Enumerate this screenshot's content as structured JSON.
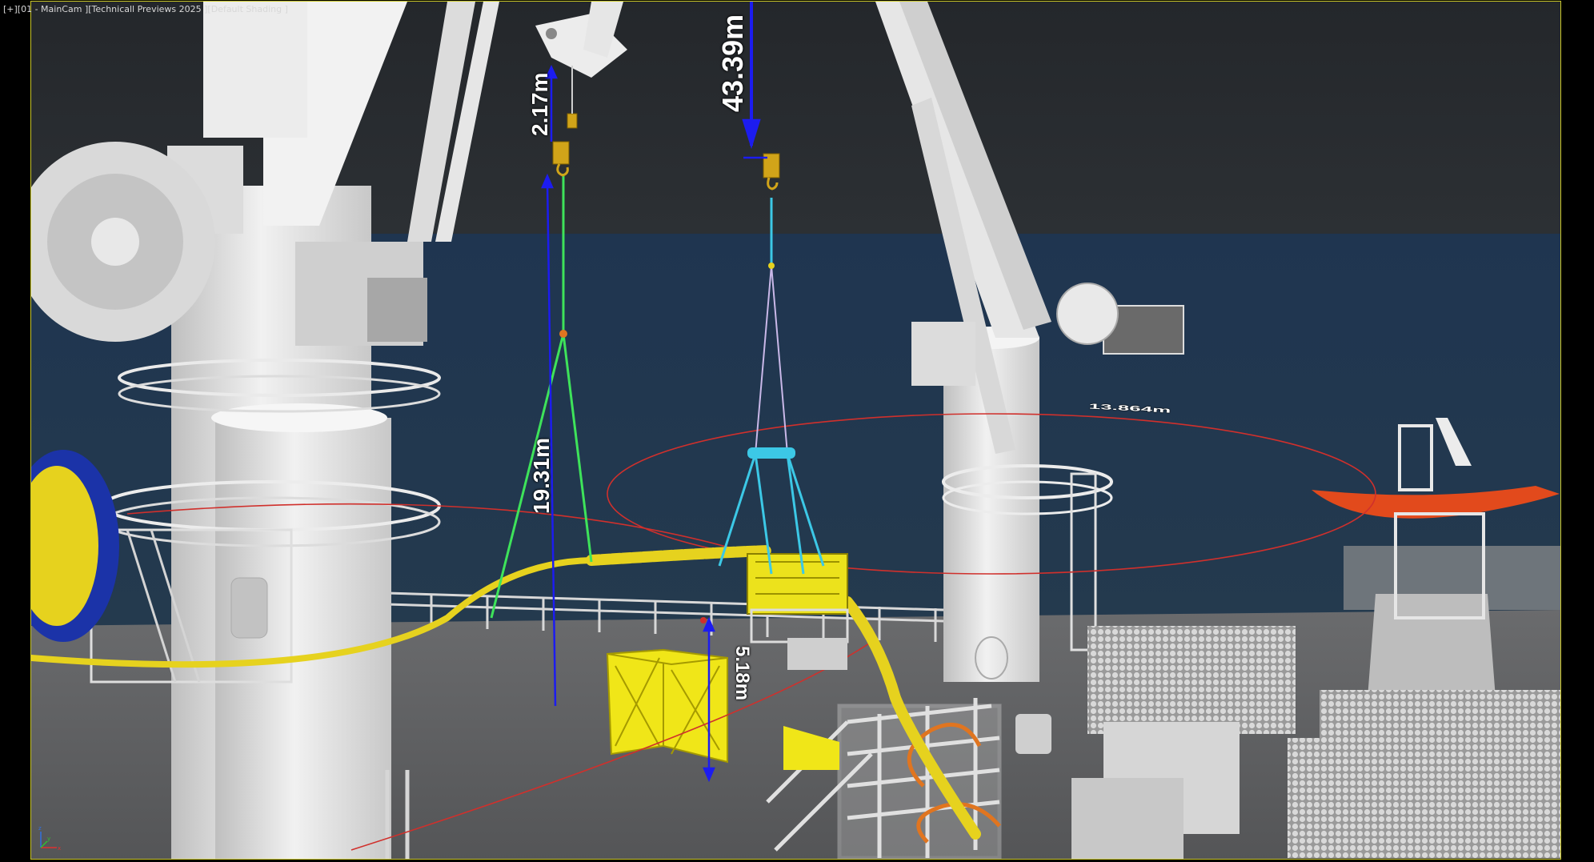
{
  "viewport": {
    "label": "[+][01 - MainCam ][Technicall Previews 2025 ][Default Shading ]",
    "frame_color": "#c9c628"
  },
  "measurements": {
    "top_left": "2.17m",
    "top_center": "43.39m",
    "left_span": "19.31m",
    "crate_height": "5.18m",
    "radius": "13.864m"
  },
  "colors": {
    "sky": "#262a2e",
    "sea": "#1f3246",
    "deck": "#5d5e60",
    "crane": "#e4e4e4",
    "cable_yellow": "#e6d21e",
    "module_yellow": "#f0e618",
    "rigging_green": "#3ee35a",
    "rigging_cyan": "#3cc8e6",
    "dimension_blue": "#1c1cf0",
    "radius_red": "#d0302c",
    "boat_orange": "#e24a1c"
  },
  "icons": {
    "viewport_menu": "chevron-down-icon",
    "axis_gizmo": "xyz-axis-icon"
  }
}
